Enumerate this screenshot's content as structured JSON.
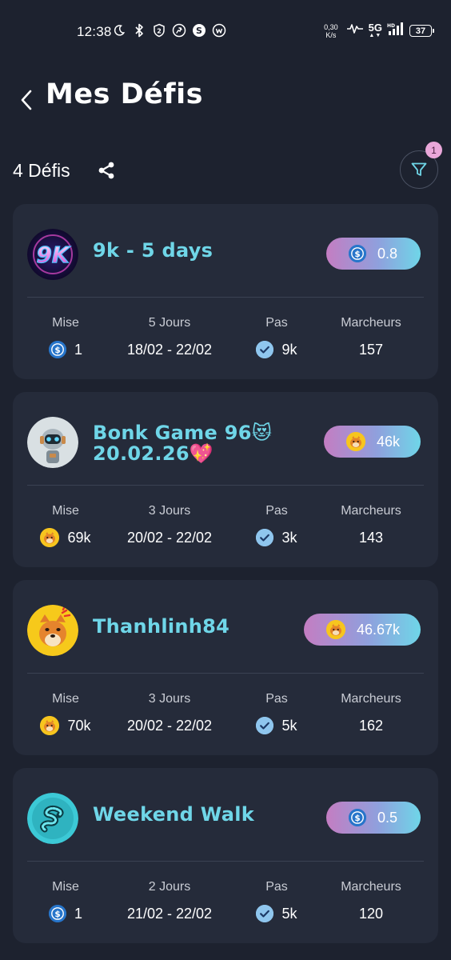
{
  "status_bar": {
    "time": "12:38",
    "net_speed_value": "0,30",
    "net_speed_unit": "K/s",
    "network": "5G",
    "battery": "37"
  },
  "header": {
    "title": "Mes Défis"
  },
  "summary": {
    "count_label": "4 Défis",
    "filter_badge": "1"
  },
  "colors": {
    "background": "#1d222f",
    "card": "#252b3a",
    "accent_cyan": "#6fd6e8",
    "pill_pink": "#c47dc2",
    "badge_pink": "#e9a7d9"
  },
  "labels": {
    "stake": "Mise",
    "steps": "Pas",
    "walkers": "Marcheurs"
  },
  "challenges": [
    {
      "name": "9k - 5 days",
      "avatar": "9k-logo-avatar",
      "reward_token": "usdc-coin-icon",
      "reward": "0.8",
      "stake_token": "usdc-coin-icon",
      "stake": "1",
      "duration": "5 Jours",
      "dates": "18/02 - 22/02",
      "steps": "9k",
      "walkers": "157"
    },
    {
      "name": "Bonk Game 96😻 20.02.26💖",
      "avatar": "robot-avatar",
      "reward_token": "bonk-coin-icon",
      "reward": "46k",
      "stake_token": "bonk-coin-icon",
      "stake": "69k",
      "duration": "3 Jours",
      "dates": "20/02 - 22/02",
      "steps": "3k",
      "walkers": "143"
    },
    {
      "name": "Thanhlinh84",
      "avatar": "bonk-dog-avatar",
      "reward_token": "bonk-coin-icon",
      "reward": "46.67k",
      "stake_token": "bonk-coin-icon",
      "stake": "70k",
      "duration": "3 Jours",
      "dates": "20/02 - 22/02",
      "steps": "5k",
      "walkers": "162"
    },
    {
      "name": "Weekend Walk",
      "avatar": "squiggle-pixel-avatar",
      "reward_token": "usdc-coin-icon",
      "reward": "0.5",
      "stake_token": "usdc-coin-icon",
      "stake": "1",
      "duration": "2 Jours",
      "dates": "21/02 - 22/02",
      "steps": "5k",
      "walkers": "120"
    }
  ]
}
